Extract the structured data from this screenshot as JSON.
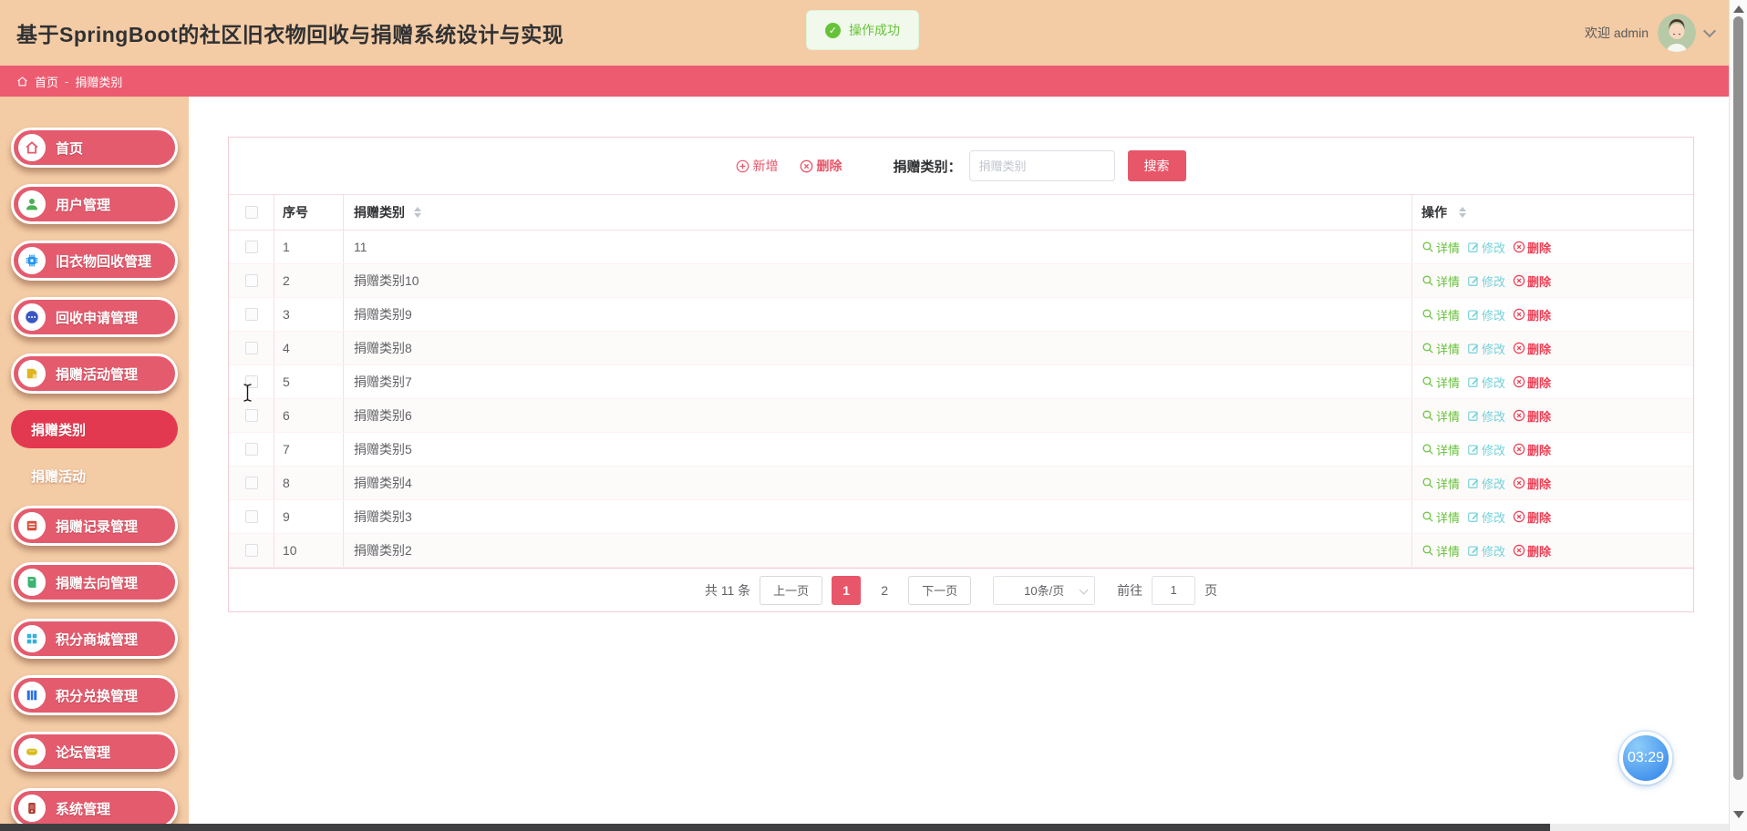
{
  "app": {
    "title": "基于SpringBoot的社区旧衣物回收与捐赠系统设计与实现"
  },
  "toast": {
    "message": "操作成功"
  },
  "user": {
    "welcome": "欢迎 admin"
  },
  "breadcrumb": {
    "home": "首页",
    "separator": "-",
    "current": "捐赠类别"
  },
  "sidebar": {
    "items": [
      {
        "label": "首页",
        "icon": "home-icon"
      },
      {
        "label": "用户管理",
        "icon": "user-icon"
      },
      {
        "label": "旧衣物回收管理",
        "icon": "chip-icon"
      },
      {
        "label": "回收申请管理",
        "icon": "more-circle-icon"
      },
      {
        "label": "捐赠活动管理",
        "icon": "donation-box-icon"
      },
      {
        "label": "捐赠记录管理",
        "icon": "archive-icon"
      },
      {
        "label": "捐赠去向管理",
        "icon": "book-icon"
      },
      {
        "label": "积分商城管理",
        "icon": "grid-icon"
      },
      {
        "label": "积分兑换管理",
        "icon": "columns-icon"
      },
      {
        "label": "论坛管理",
        "icon": "forum-icon"
      },
      {
        "label": "系统管理",
        "icon": "system-icon"
      }
    ],
    "submenu": [
      {
        "label": "捐赠类别",
        "active": true
      },
      {
        "label": "捐赠活动",
        "active": false
      }
    ]
  },
  "toolbar": {
    "add": "新增",
    "delete": "删除",
    "search_label": "捐赠类别：",
    "search_placeholder": "捐赠类别",
    "search_button": "搜索"
  },
  "table": {
    "headers": {
      "index": "序号",
      "category": "捐赠类别",
      "actions": "操作"
    },
    "actions": {
      "detail": "详情",
      "edit": "修改",
      "delete": "删除"
    },
    "rows": [
      {
        "index": "1",
        "category": "11"
      },
      {
        "index": "2",
        "category": "捐赠类别10"
      },
      {
        "index": "3",
        "category": "捐赠类别9"
      },
      {
        "index": "4",
        "category": "捐赠类别8"
      },
      {
        "index": "5",
        "category": "捐赠类别7"
      },
      {
        "index": "6",
        "category": "捐赠类别6"
      },
      {
        "index": "7",
        "category": "捐赠类别5"
      },
      {
        "index": "8",
        "category": "捐赠类别4"
      },
      {
        "index": "9",
        "category": "捐赠类别3"
      },
      {
        "index": "10",
        "category": "捐赠类别2"
      }
    ]
  },
  "pagination": {
    "total": "共 11 条",
    "prev": "上一页",
    "page1": "1",
    "page2": "2",
    "next": "下一页",
    "page_size": "10条/页",
    "goto_label": "前往",
    "goto_value": "1",
    "goto_suffix": "页"
  },
  "clock": {
    "time": "03:29"
  },
  "colors": {
    "accent": "#e8566a",
    "header_bg": "#f3cba5",
    "breadcrumb_bg": "#ec5b70",
    "success": "#67c23a",
    "edit": "#72d1d8",
    "delete": "#ed3f54"
  }
}
